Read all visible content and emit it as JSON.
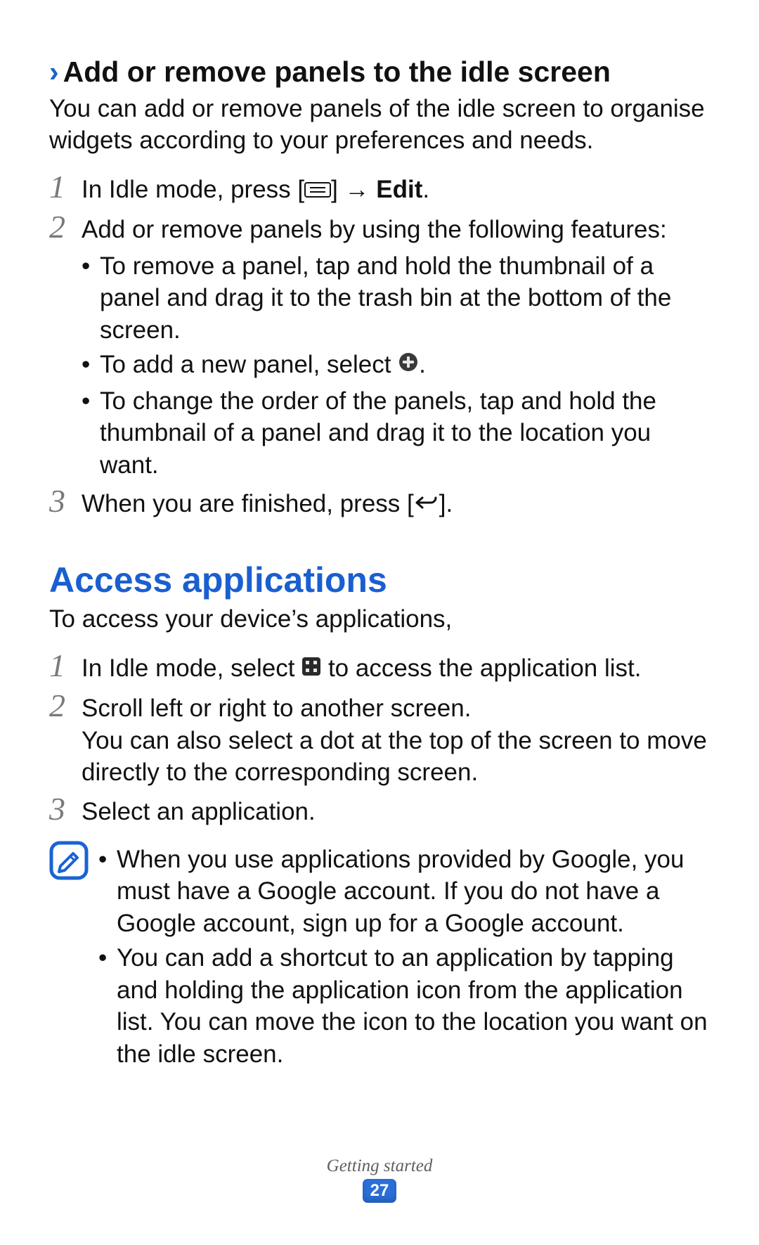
{
  "section1": {
    "heading": "Add or remove panels to the idle screen",
    "intro": "You can add or remove panels of the idle screen to organise widgets according to your preferences and needs.",
    "steps": {
      "s1_prefix": "In Idle mode, press [",
      "s1_arrow": "] → ",
      "s1_bold": "Edit",
      "s1_suffix": ".",
      "s2": "Add or remove panels by using the following features:",
      "s2_b1": "To remove a panel, tap and hold the thumbnail of a panel and drag it to the trash bin at the bottom of the screen.",
      "s2_b2_prefix": "To add a new panel, select ",
      "s2_b2_suffix": ".",
      "s2_b3": "To change the order of the panels, tap and hold the thumbnail of a panel and drag it to the location you want.",
      "s3_prefix": "When you are finished, press [",
      "s3_suffix": "]."
    }
  },
  "section2": {
    "title": "Access applications",
    "intro": "To access your device’s applications,",
    "steps": {
      "s1_prefix": "In Idle mode, select ",
      "s1_suffix": " to access the application list.",
      "s2a": "Scroll left or right to another screen.",
      "s2b": "You can also select a dot at the top of the screen to move directly to the corresponding screen.",
      "s3": "Select an application."
    },
    "note": {
      "b1": "When you use applications provided by Google, you must have a Google account. If you do not have a Google account, sign up for a Google account.",
      "b2": "You can add a shortcut to an application by tapping and holding the application icon from the application list. You can move the icon to the location you want on the idle screen."
    }
  },
  "footer": {
    "label": "Getting started",
    "page": "27"
  },
  "icons": {
    "menu": "menu-icon",
    "plus": "plus-circle-icon",
    "back": "back-icon",
    "apps": "apps-grid-icon",
    "note": "note-pencil-icon"
  }
}
